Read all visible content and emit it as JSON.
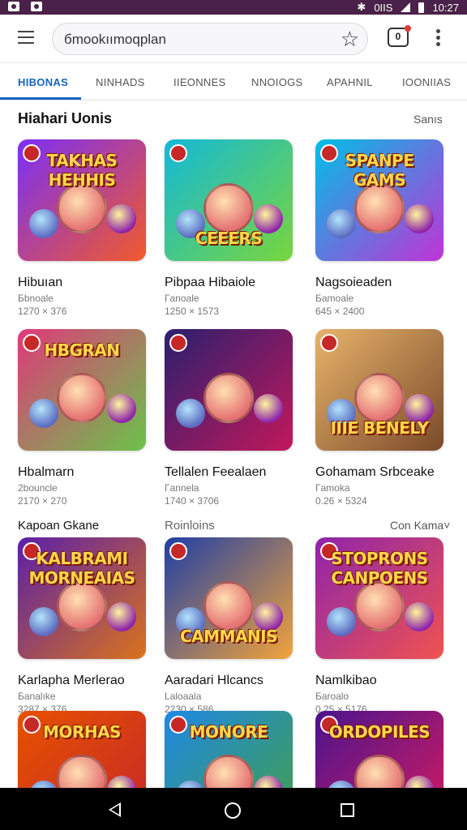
{
  "status": {
    "right_text": "0IIS",
    "time": "10:27"
  },
  "search": {
    "value": "бmookıımoqplan",
    "star_icon": "star-icon",
    "tab_count": "0"
  },
  "tabs": [
    "HIBONAS",
    "NINHADS",
    "IIEONNES",
    "NNOIOGS",
    "APAHNIL",
    "IOONIIAS"
  ],
  "section1": {
    "title": "Hiahari Uonis",
    "link": "Sanıs"
  },
  "section2": {
    "title": "Kapoan Gkane",
    "mid": "Roinloins",
    "link": "Con Kama˅"
  },
  "cards": [
    {
      "name": "Hibuıan",
      "sub": "Бbnoale",
      "size": "1270 × 376",
      "title": "TAKHAS HEHHIS",
      "bg": [
        "#7b2ff7",
        "#f15a29"
      ]
    },
    {
      "name": "Pibpaa Hibaiole",
      "sub": "Гanoale",
      "size": "1250 × 1573",
      "title": "CEEERS",
      "bg": [
        "#13b8d9",
        "#79d63b"
      ]
    },
    {
      "name": "Nagsoieaden",
      "sub": "Бamoale",
      "size": "645 × 2400",
      "title": "SPANPE GAMS",
      "bg": [
        "#00bfe6",
        "#c033d6"
      ]
    },
    {
      "name": "Hbalmarn",
      "sub": "2bouncle",
      "size": "2170 × 270",
      "title": "HBGRAN",
      "bg": [
        "#e0397a",
        "#6cc24a"
      ]
    },
    {
      "name": "Tellalen Feealaen",
      "sub": "Гannela",
      "size": "1740 × 3706",
      "title": "",
      "bg": [
        "#2a1f6e",
        "#c2185b"
      ]
    },
    {
      "name": "Gohamam Srbceake",
      "sub": "Гamoka",
      "size": "0.26 × 5324",
      "title": "IIIE BENELY",
      "bg": [
        "#e8b36a",
        "#7a4a2a"
      ]
    },
    {
      "name": "Karlapha Merlerao",
      "sub": "Бanalıke",
      "size": "3287 × 376",
      "title": "KALBRAMI MORNEAIAS",
      "bg": [
        "#5b1fa8",
        "#d9731c"
      ]
    },
    {
      "name": "Aaradari Hlcancs",
      "sub": "Laloaala",
      "size": "2230 × 586",
      "title": "CAMMANIS",
      "bg": [
        "#1f3fa6",
        "#f2a33a"
      ]
    },
    {
      "name": "Namlkibao",
      "sub": "Бaroalo",
      "size": "0.25 × 5176",
      "title": "STOPRONS CANPOENS",
      "bg": [
        "#8e24aa",
        "#ef5350"
      ]
    },
    {
      "name": "",
      "sub": "",
      "size": "",
      "title": "MORHAS",
      "bg": [
        "#e65100",
        "#c62828"
      ]
    },
    {
      "name": "",
      "sub": "",
      "size": "",
      "title": "MONORE",
      "bg": [
        "#1e88e5",
        "#43a047"
      ]
    },
    {
      "name": "",
      "sub": "",
      "size": "",
      "title": "ORDOPILES",
      "bg": [
        "#4a148c",
        "#d81b60"
      ]
    }
  ]
}
